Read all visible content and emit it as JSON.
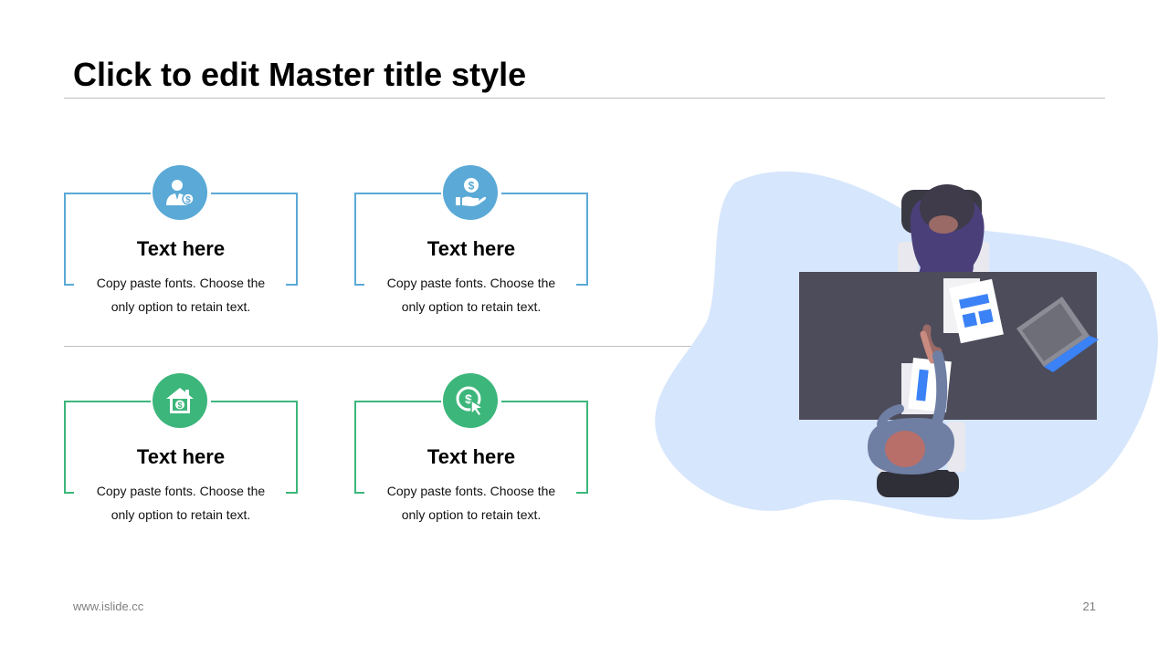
{
  "slide": {
    "title": "Click to edit Master title style",
    "footer_url": "www.islide.cc",
    "page_number": "21"
  },
  "colors": {
    "blue_accent": "#5aa9d6",
    "green_accent": "#3cb67b",
    "blob": "#d6e6fc",
    "desk": "#4d4c5a",
    "rule": "#bfbfbf"
  },
  "cards": [
    {
      "heading": "Text here",
      "line1": "Copy paste fonts. Choose the",
      "line2": "only option to retain text.",
      "icon": "businessman-dollar-icon"
    },
    {
      "heading": "Text here",
      "line1": "Copy paste fonts. Choose the",
      "line2": "only option to retain text.",
      "icon": "hand-coin-icon"
    },
    {
      "heading": "Text here",
      "line1": "Copy paste fonts. Choose the",
      "line2": "only option to retain text.",
      "icon": "house-dollar-icon"
    },
    {
      "heading": "Text here",
      "line1": "Copy paste fonts. Choose the",
      "line2": "only option to retain text.",
      "icon": "coin-cursor-icon"
    }
  ],
  "illustration": {
    "icon": "business-handshake-illustration",
    "dollar_symbol": "$"
  }
}
